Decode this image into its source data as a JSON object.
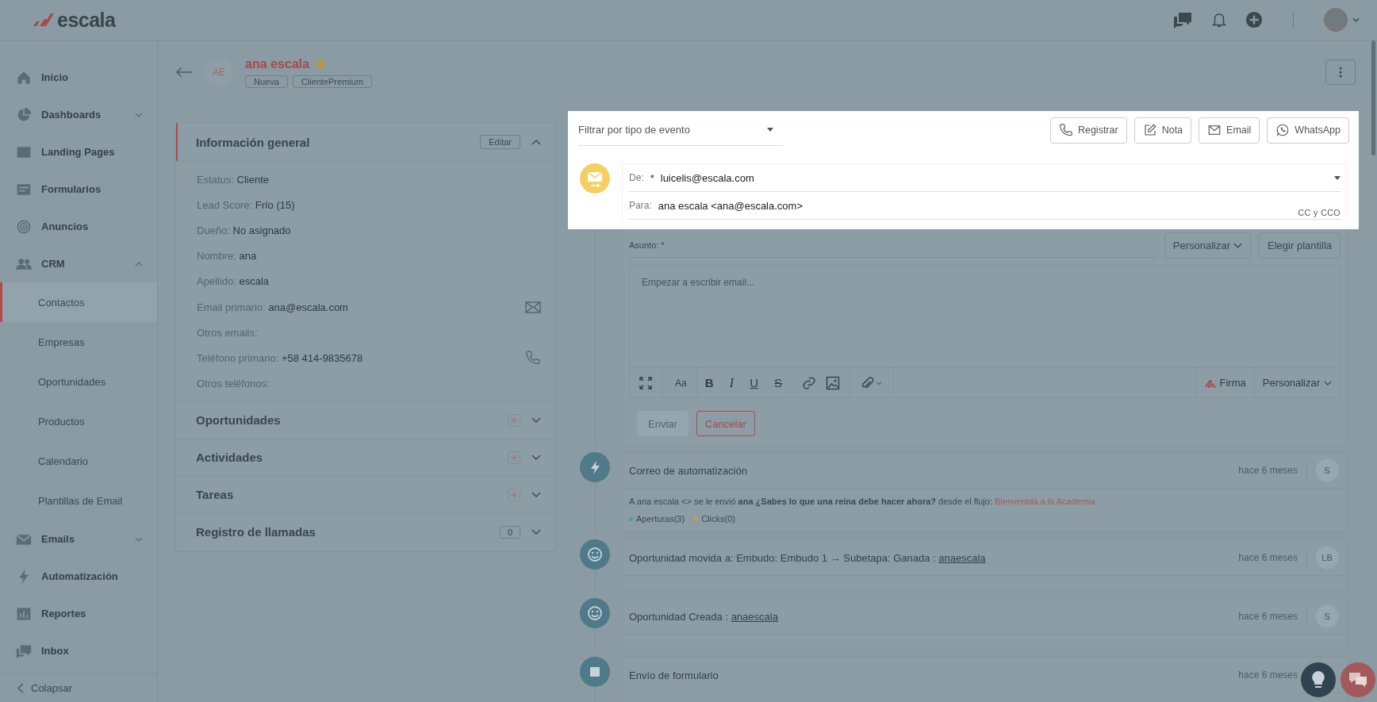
{
  "brand": {
    "name": "escala"
  },
  "sidebar": {
    "items": [
      {
        "label": "Inicio",
        "kind": "link"
      },
      {
        "label": "Dashboards",
        "kind": "group",
        "expanded": false
      },
      {
        "label": "Landing Pages",
        "kind": "link"
      },
      {
        "label": "Formularios",
        "kind": "link"
      },
      {
        "label": "Anuncios",
        "kind": "link"
      },
      {
        "label": "CRM",
        "kind": "group",
        "expanded": true,
        "children": [
          {
            "label": "Contactos",
            "selected": true
          },
          {
            "label": "Empresas",
            "selected": false
          },
          {
            "label": "Oportunidades",
            "selected": false
          },
          {
            "label": "Productos",
            "selected": false
          },
          {
            "label": "Calendario",
            "selected": false
          },
          {
            "label": "Plantillas de Email",
            "selected": false
          }
        ]
      },
      {
        "label": "Emails",
        "kind": "group",
        "expanded": false
      },
      {
        "label": "Automatización",
        "kind": "link"
      },
      {
        "label": "Reportes",
        "kind": "link"
      },
      {
        "label": "Inbox",
        "kind": "link"
      }
    ],
    "collapse": "Colapsar"
  },
  "contact": {
    "initials": "AE",
    "name": "ana escala",
    "favorite": true,
    "tags": [
      "Nueva",
      "ClientePremium"
    ]
  },
  "info": {
    "title": "Información general",
    "edit": "Editar",
    "expanded": true,
    "fields": [
      {
        "label": "Estatus:",
        "value": "Cliente",
        "kind": "plain"
      },
      {
        "label": "Lead Score:",
        "value": "Frío (15)",
        "kind": "plain"
      },
      {
        "label": "Dueño:",
        "value": "No asignado",
        "kind": "plain"
      },
      {
        "label": "Nombre:",
        "value": "ana",
        "kind": "plain"
      },
      {
        "label": "Apellido:",
        "value": "escala",
        "kind": "plain"
      },
      {
        "label": "Email primario:",
        "value": "ana@escala.com",
        "kind": "email"
      },
      {
        "label": "Otros emails:",
        "kind": "plain"
      },
      {
        "label": "Teléfono primario:",
        "value": "+58 414-9835678",
        "kind": "phone"
      },
      {
        "label": "Otros teléfonos:",
        "kind": "plain"
      }
    ]
  },
  "sections": [
    {
      "title": "Oportunidades",
      "kind": "add",
      "expanded": false
    },
    {
      "title": "Actividades",
      "kind": "add",
      "expanded": false
    },
    {
      "title": "Tareas",
      "kind": "add",
      "expanded": false
    },
    {
      "title": "Registro de llamadas",
      "kind": "count",
      "count": "0",
      "expanded": false
    }
  ],
  "timeline": {
    "filter": "Filtrar por tipo de evento",
    "actions": [
      "Registrar",
      "Nota",
      "Email",
      "WhatsApp"
    ],
    "composer": {
      "from_label": "De:",
      "required": "*",
      "from": "luicelis@escala.com",
      "to_label": "Para:",
      "to": "ana escala <ana@escala.com>",
      "cc": "CC y CCO",
      "subject_placeholder": "Asunto: *",
      "personalize": "Personalizar",
      "template": "Elegir plantilla",
      "body_placeholder": "Empezar a escribir email...",
      "text_tools": [
        "Aa",
        "B",
        "I",
        "U",
        "S"
      ],
      "signature": "Firma",
      "personalize_menu": "Personalizar",
      "send": {
        "label": "Enviar",
        "disabled": true
      },
      "cancel": "Cancelar"
    },
    "events": [
      {
        "kind": "automation",
        "title": "Correo de automatización",
        "time": "hace 6 meses",
        "user": "S",
        "body": "A ana escala <> se le envió **ana ¿Sabes lo que una reina debe hacer ahora?** desde el flujo: ",
        "link": "Bienvenida a la Academia",
        "stats": [
          {
            "label": "Aperturas(3)",
            "color": "#4a9ea0"
          },
          {
            "label": "Clicks(0)",
            "color": "#c9a23a"
          }
        ]
      },
      {
        "kind": "deal",
        "title": "Oportunidad movida a: Embudo: Embudo 1 → Subetapa: Ganada : ",
        "title_link": "anaescala",
        "time": "hace 6 meses",
        "user": "LB"
      },
      {
        "kind": "deal",
        "title": "Oportunidad Creada : ",
        "title_link": "anaescala",
        "time": "hace 6 meses",
        "user": "S"
      },
      {
        "kind": "form",
        "title": "Envío de formulario",
        "time": "hace 6 meses"
      }
    ]
  }
}
